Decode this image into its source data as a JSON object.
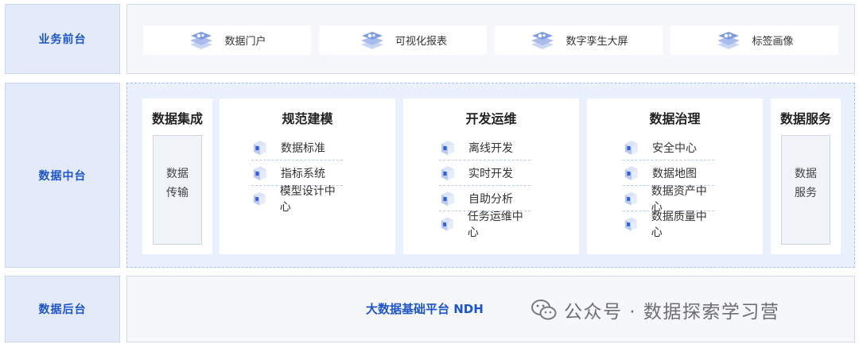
{
  "layers": {
    "front": "业务前台",
    "middle": "数据中台",
    "back": "数据后台"
  },
  "front_apps": [
    {
      "label": "数据门户"
    },
    {
      "label": "可视化报表"
    },
    {
      "label": "数字孪生大屏"
    },
    {
      "label": "标签画像"
    }
  ],
  "middle": {
    "integration": {
      "title": "数据集成",
      "inner": "数据\n传输"
    },
    "modeling": {
      "title": "规范建模",
      "items": [
        "数据标准",
        "指标系统",
        "模型设计中心"
      ]
    },
    "devops": {
      "title": "开发运维",
      "items": [
        "离线开发",
        "实时开发",
        "自助分析",
        "任务运维中心"
      ]
    },
    "governance": {
      "title": "数据治理",
      "items": [
        "安全中心",
        "数据地图",
        "数据资产中心",
        "数据质量中心"
      ]
    },
    "service": {
      "title": "数据服务",
      "inner": "数据\n服务"
    }
  },
  "back": {
    "platform": "大数据基础平台 NDH",
    "watermark": "公众号 · 数据探索学习营"
  },
  "icons": {
    "app": "isometric-stack-icon",
    "item": "cube-icon",
    "watermark": "wechat-icon"
  },
  "colors": {
    "accent": "#1d55c8",
    "label_bg": "#e3ebfa",
    "middle_bg": "#eaf1fd",
    "panel_bg": "#f5f7fb"
  }
}
